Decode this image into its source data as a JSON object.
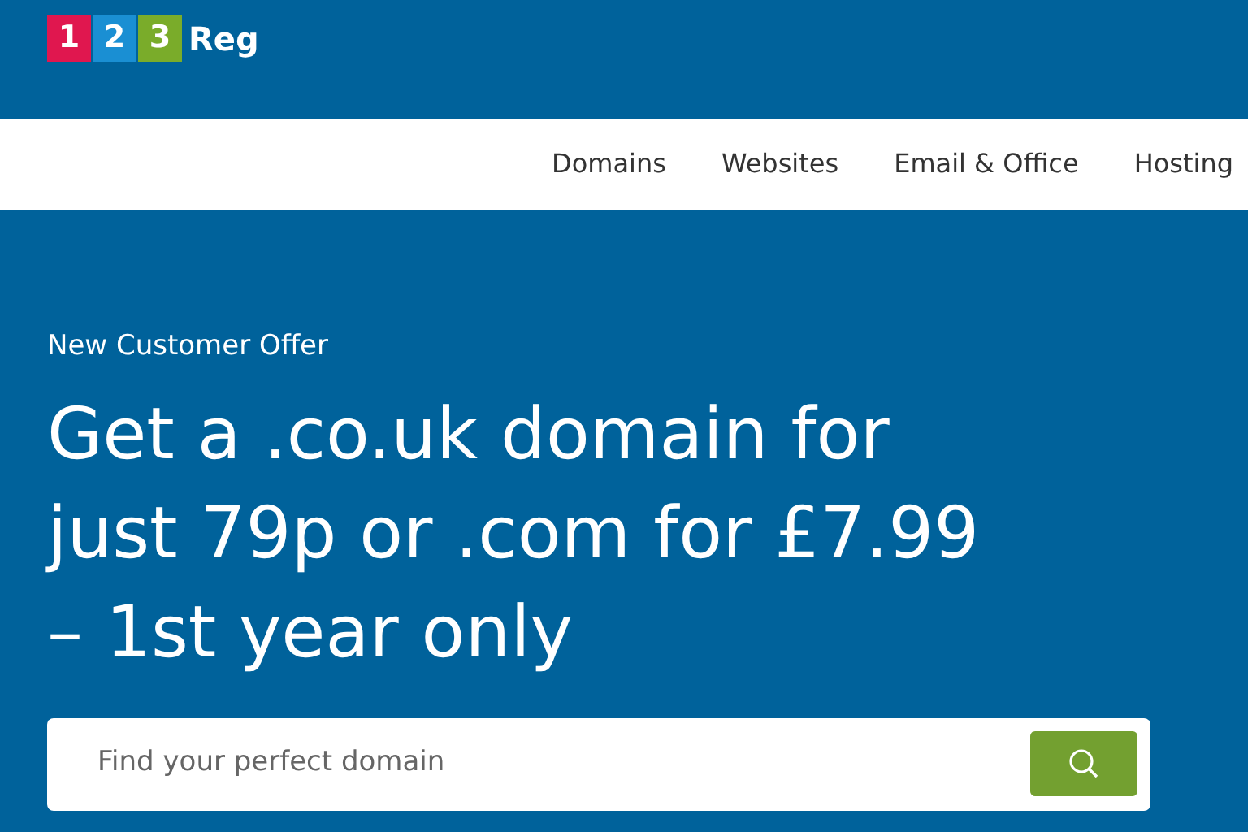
{
  "logo": {
    "digits": [
      {
        "text": "1",
        "color": "#e0174f"
      },
      {
        "text": "2",
        "color": "#1a8fd3"
      },
      {
        "text": "3",
        "color": "#7aac2a"
      }
    ],
    "name": "Reg"
  },
  "nav": {
    "items": [
      "Domains",
      "Websites",
      "Email & Office",
      "Hosting"
    ]
  },
  "hero": {
    "eyebrow": "New Customer Offer",
    "headline": [
      "Get a .co.uk domain for",
      "just 79p or .com for £7.99",
      "– 1st year only"
    ]
  },
  "search": {
    "placeholder": "Find your perfect domain"
  }
}
